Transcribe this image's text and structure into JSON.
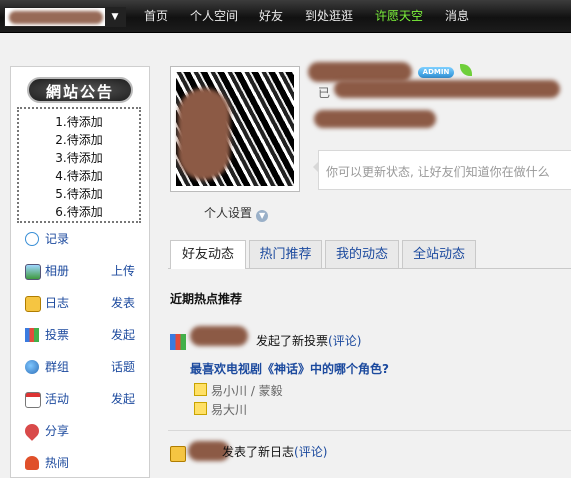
{
  "topbar": {
    "nav": [
      "首页",
      "个人空间",
      "好友",
      "到处逛逛",
      "许愿天空",
      "消息"
    ]
  },
  "sidebar": {
    "notice_title": "網站公告",
    "notices": [
      "1.待添加",
      "2.待添加",
      "3.待添加",
      "4.待添加",
      "5.待添加",
      "6.待添加"
    ],
    "items": [
      {
        "label": "记录",
        "action": ""
      },
      {
        "label": "相册",
        "action": "上传"
      },
      {
        "label": "日志",
        "action": "发表"
      },
      {
        "label": "投票",
        "action": "发起"
      },
      {
        "label": "群组",
        "action": "话题"
      },
      {
        "label": "活动",
        "action": "发起"
      },
      {
        "label": "分享",
        "action": ""
      },
      {
        "label": "热闹",
        "action": ""
      }
    ]
  },
  "profile": {
    "settings_label": "个人设置",
    "badge": "ADMIN",
    "line2_prefix": "已",
    "status_placeholder": "你可以更新状态, 让好友们知道你在做什么"
  },
  "tabs": [
    "好友动态",
    "热门推荐",
    "我的动态",
    "全站动态"
  ],
  "feed": {
    "section_title": "近期热点推荐",
    "items": [
      {
        "action": "发起了新投票",
        "comment": "(评论)"
      },
      {
        "action": "发表了新日志",
        "comment": "(评论)"
      }
    ],
    "poll": {
      "question": "最喜欢电视剧《神话》中的哪个角色?",
      "options": [
        "易小川 / 蒙毅",
        "易大川"
      ]
    }
  },
  "colors": {
    "highlight_nav": "#7cf23a",
    "link": "#1c4a9e"
  }
}
